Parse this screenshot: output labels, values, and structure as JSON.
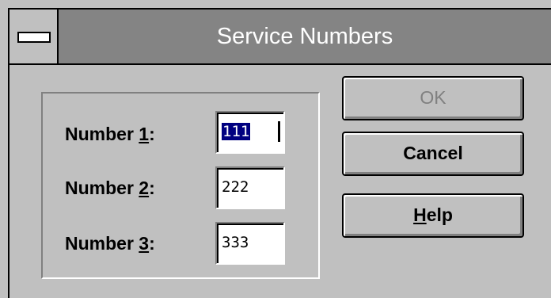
{
  "window": {
    "title": "Service Numbers"
  },
  "fields": [
    {
      "label_prefix": "Number ",
      "mnemonic": "1",
      "label_suffix": ":",
      "value": "111"
    },
    {
      "label_prefix": "Number ",
      "mnemonic": "2",
      "label_suffix": ":",
      "value": "222"
    },
    {
      "label_prefix": "Number ",
      "mnemonic": "3",
      "label_suffix": ":",
      "value": "333"
    }
  ],
  "buttons": {
    "ok": {
      "label": "OK",
      "enabled": false
    },
    "cancel": {
      "label": "Cancel"
    },
    "help": {
      "mnemonic": "H",
      "rest": "elp"
    }
  },
  "icons": {
    "system_menu": "system-menu-icon"
  },
  "colors": {
    "titlebar": "#848484",
    "face": "#c0c0c0",
    "selection": "#000080"
  }
}
